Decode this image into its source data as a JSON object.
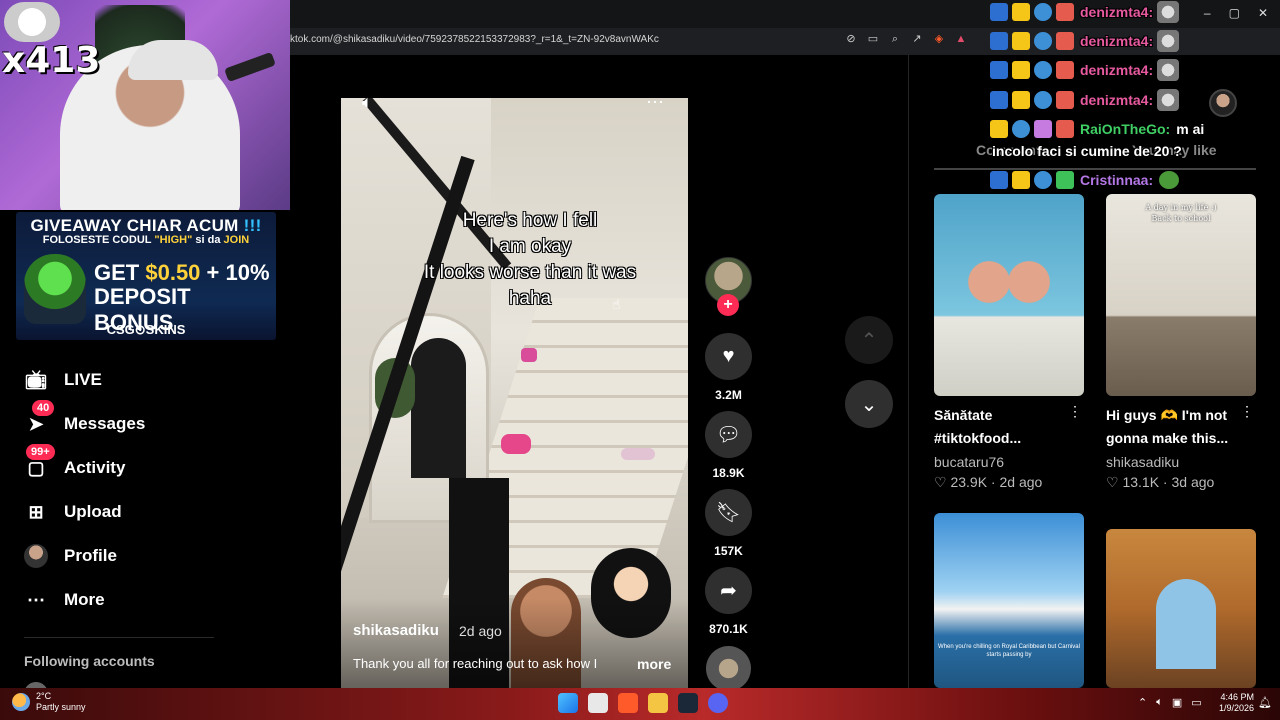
{
  "browser": {
    "url": "ktok.com/@shikasadiku/video/7592378522153372983?_r=1&_t=ZN-92v8avnWAKc",
    "window_controls": [
      "–",
      "▢",
      "✕"
    ]
  },
  "stream_overlay": {
    "webcam_counter": "x413",
    "giveaway": {
      "title": "GIVEAWAY CHIAR ACUM",
      "title_suffix": "!!!",
      "code_prefix": "FOLOSESTE CODUL",
      "code": "\"HIGH\"",
      "code_suffix": "si da",
      "code_action": "JOIN",
      "bonus_prefix": "GET",
      "bonus_amount": "$0.50",
      "bonus_rest": "+ 10%",
      "bonus_line2": "DEPOSIT BONUS",
      "brand": "CSG⊙SKINS"
    },
    "chat": [
      {
        "user": "denizmta4:",
        "user_color": "#e85aa0",
        "msg": ""
      },
      {
        "user": "denizmta4:",
        "user_color": "#e85aa0",
        "msg": ""
      },
      {
        "user": "denizmta4:",
        "user_color": "#e85aa0",
        "msg": ""
      },
      {
        "user": "denizmta4:",
        "user_color": "#e85aa0",
        "msg": ""
      },
      {
        "user": "RaiOnTheGo:",
        "user_color": "#3fcf64",
        "msg": "m ai"
      },
      {
        "user": "Cristinnaa:",
        "user_color": "#b477e6",
        "msg": ""
      }
    ],
    "chat_continuation": "incolo faci si cumine de 20 ?"
  },
  "sidebar": {
    "items": [
      {
        "label": "LIVE",
        "icon": "live-tv-icon",
        "badge": ""
      },
      {
        "label": "Messages",
        "icon": "send-icon",
        "badge": "40"
      },
      {
        "label": "Activity",
        "icon": "inbox-icon",
        "badge": "99+"
      },
      {
        "label": "Upload",
        "icon": "plus-square-icon",
        "badge": ""
      },
      {
        "label": "Profile",
        "icon": "avatar",
        "badge": ""
      },
      {
        "label": "More",
        "icon": "more-dots-icon",
        "badge": ""
      }
    ],
    "following_title": "Following accounts"
  },
  "video": {
    "caption_lines": [
      "Here's how I fell",
      "I am okay",
      "It looks worse than it was",
      "haha"
    ],
    "author": "shikasadiku",
    "time": "2d ago",
    "description": "Thank you all for reaching out to ask how I",
    "more_label": "more",
    "stats": {
      "likes": "3.2M",
      "comments": "18.9K",
      "saves": "157K",
      "shares": "870.1K"
    },
    "follow_symbol": "+"
  },
  "right_panel": {
    "tab_comments": "Comments",
    "tab_you_may_like": "You may like",
    "cards": [
      {
        "title": "Sănătate #tiktokfood...",
        "author": "bucataru76",
        "likes": "23.9K",
        "time": "2d ago",
        "overlay": ""
      },
      {
        "title": "Hi guys 🫶 I'm not gonna make this...",
        "author": "shikasadiku",
        "likes": "13.1K",
        "time": "3d ago",
        "overlay": "A day in my life :)\nBack to school"
      },
      {
        "title": "",
        "author": "",
        "likes": "",
        "time": "",
        "overlay": "When you're chilling on Royal Caribbean but Carnival starts passing by"
      },
      {
        "title": "",
        "author": "",
        "likes": "",
        "time": "",
        "overlay": ""
      }
    ]
  },
  "taskbar": {
    "temp": "2°C",
    "condition": "Partly sunny",
    "time": "4:46 PM",
    "date": "1/9/2026"
  }
}
